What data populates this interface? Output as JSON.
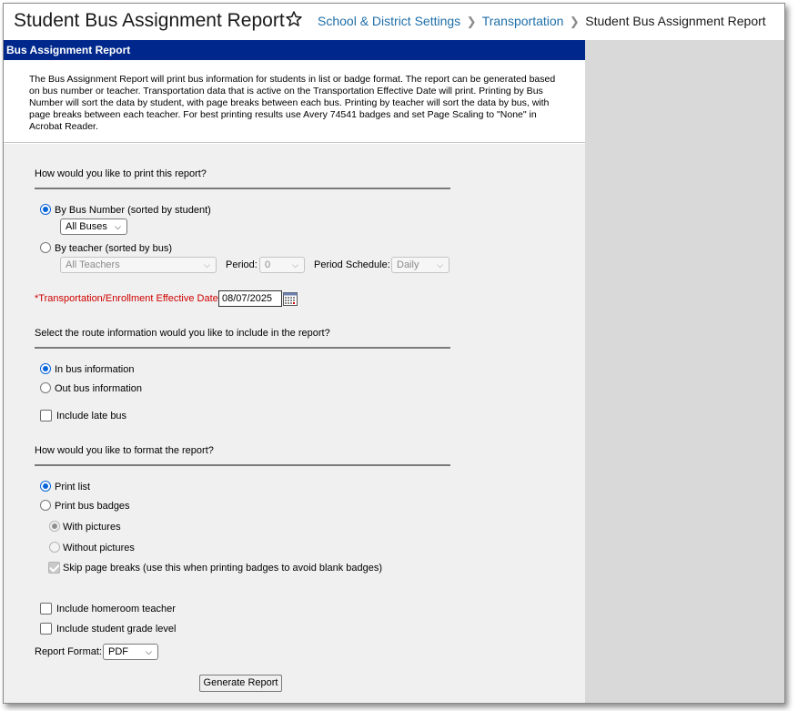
{
  "header": {
    "title": "Student Bus Assignment Report",
    "breadcrumbs": [
      "School & District Settings",
      "Transportation",
      "Student Bus Assignment Report"
    ]
  },
  "panel": {
    "title": "Bus Assignment Report",
    "description": "The Bus Assignment Report will print bus information for students in list or badge format. The report can be generated based on bus number or teacher. Transportation data that is active on the Transportation Effective Date will print. Printing by Bus Number will sort the data by student, with page breaks between each bus. Printing by teacher will sort the data by bus, with page breaks between each teacher. For best printing results use Avery 74541 badges and set Page Scaling to \"None\" in Acrobat Reader."
  },
  "print_section": {
    "question": "How would you like to print this report?",
    "by_bus_label": "By Bus Number (sorted by student)",
    "bus_select_value": "All Buses",
    "by_teacher_label": "By teacher (sorted by bus)",
    "teacher_select_value": "All Teachers",
    "period_label": "Period:",
    "period_value": "0",
    "schedule_label": "Period Schedule:",
    "schedule_value": "Daily",
    "date_label": "*Transportation/Enrollment Effective Date:",
    "date_value": "08/07/2025"
  },
  "route_section": {
    "question": "Select the route information would you like to include in the report?",
    "in_bus": "In bus information",
    "out_bus": "Out bus information",
    "late_bus": "Include late bus"
  },
  "format_section": {
    "question": "How would you like to format the report?",
    "print_list": "Print list",
    "print_badges": "Print bus badges",
    "with_pictures": "With pictures",
    "without_pictures": "Without pictures",
    "skip_breaks": "Skip page breaks (use this when printing badges to avoid blank badges)",
    "homeroom": "Include homeroom teacher",
    "grade_level": "Include student grade level",
    "report_format_label": "Report Format:",
    "report_format_value": "PDF",
    "generate_label": "Generate Report"
  },
  "colors": {
    "header_bar": "#00288c",
    "link": "#1f6fa8",
    "radio_accent": "#0a65d9",
    "required": "#d00000"
  }
}
